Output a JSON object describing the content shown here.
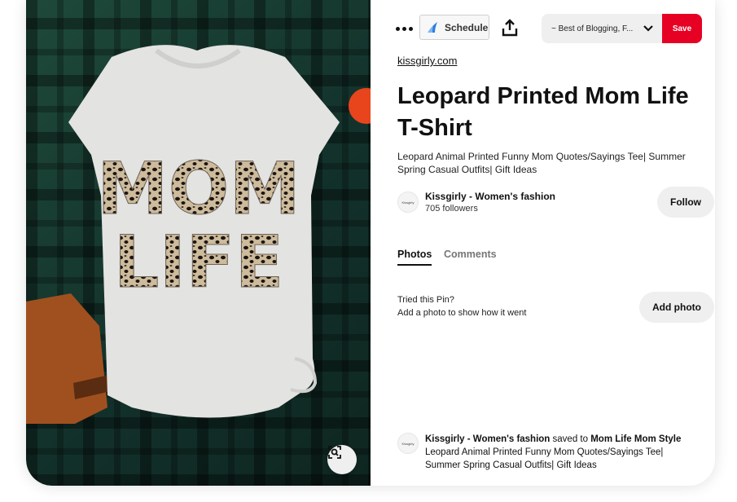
{
  "toolbar": {
    "more_icon": "more-horizontal-icon",
    "schedule_label": "Schedule",
    "share_icon": "share-upload-icon",
    "board_value": "~ Best of Blogging, F...",
    "save_label": "Save",
    "accent_color": "#e60023"
  },
  "pin": {
    "source": "kissgirly.com",
    "title": "Leopard Printed Mom Life T-Shirt",
    "description": "Leopard Animal Printed Funny Mom Quotes/Sayings Tee| Summer Spring Casual Outfits| Gift Ideas",
    "image_text": [
      "MOM",
      "LIFE"
    ]
  },
  "creator": {
    "avatar_text": "Kissgirly",
    "name": "Kissgirly - Women's fashion",
    "followers": "705 followers",
    "follow_label": "Follow"
  },
  "tabs": [
    {
      "label": "Photos",
      "active": true
    },
    {
      "label": "Comments",
      "active": false
    }
  ],
  "photos": {
    "prompt": "Tried this Pin?",
    "hint": "Add a photo to show how it went",
    "add_label": "Add photo"
  },
  "activity": {
    "avatar_text": "Kissgirly",
    "user": "Kissgirly - Women's fashion",
    "verb": " saved to ",
    "board": "Mom Life Mom Style",
    "description": "Leopard Animal Printed Funny Mom Quotes/Sayings Tee| Summer Spring Casual Outfits| Gift Ideas"
  }
}
